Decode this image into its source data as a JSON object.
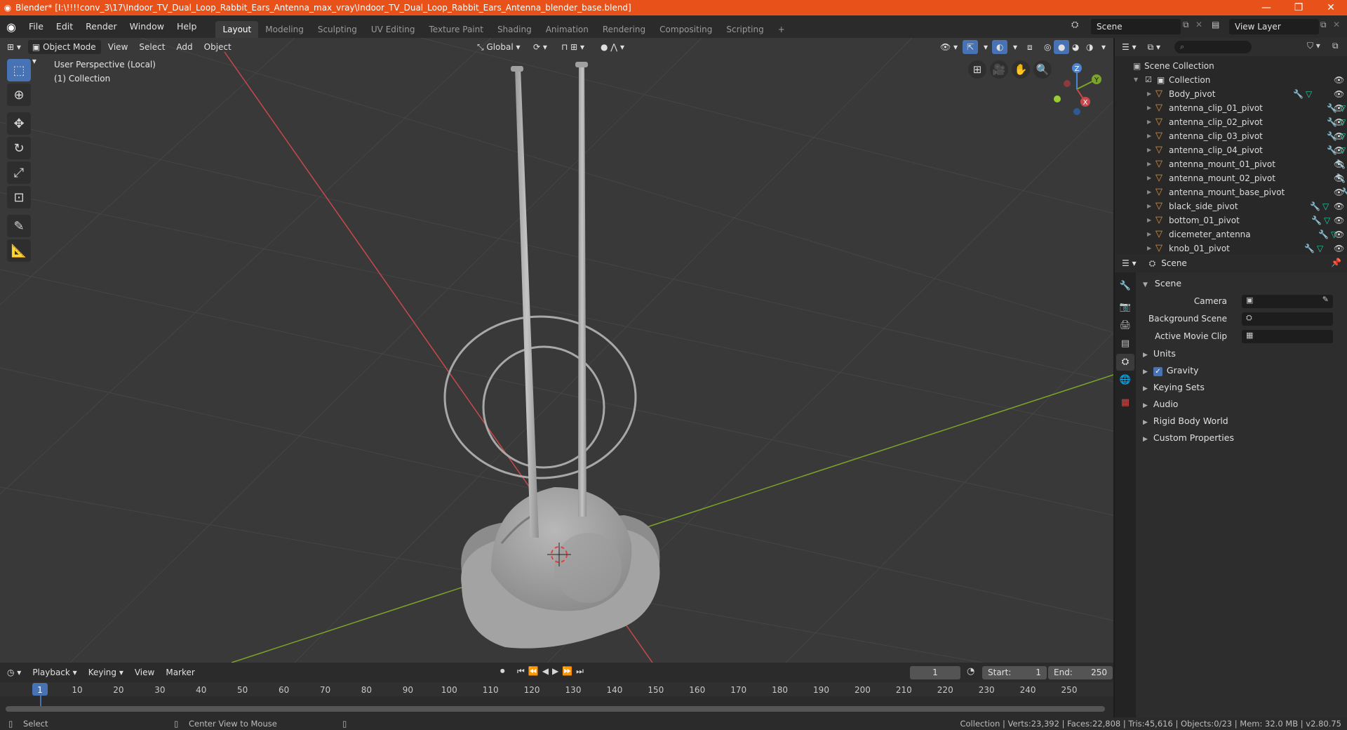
{
  "titlebar": {
    "title": "Blender* [I:\\!!!!conv_3\\17\\Indoor_TV_Dual_Loop_Rabbit_Ears_Antenna_max_vray\\Indoor_TV_Dual_Loop_Rabbit_Ears_Antenna_blender_base.blend]",
    "minimize": "—",
    "maximize": "❐",
    "close": "✕"
  },
  "menu": [
    "File",
    "Edit",
    "Render",
    "Window",
    "Help"
  ],
  "workspaces": [
    "Layout",
    "Modeling",
    "Sculpting",
    "UV Editing",
    "Texture Paint",
    "Shading",
    "Animation",
    "Rendering",
    "Compositing",
    "Scripting"
  ],
  "active_workspace": "Layout",
  "add_workspace": "+",
  "scene_selector": "Scene",
  "view_layer": "View Layer",
  "viewport": {
    "mode": "Object Mode",
    "menus": [
      "View",
      "Select",
      "Add",
      "Object"
    ],
    "orientation": "Global",
    "info_line1": "User Perspective (Local)",
    "info_line2": "(1) Collection",
    "gizmo_labels": {
      "z": "Z",
      "y": "Y",
      "x": "X"
    }
  },
  "timeline": {
    "menus": [
      "Playback",
      "Keying",
      "View",
      "Marker"
    ],
    "current_frame": "1",
    "start_label": "Start:",
    "start": "1",
    "end_label": "End:",
    "end": "250",
    "ruler": [
      "1",
      "10",
      "20",
      "30",
      "40",
      "50",
      "60",
      "70",
      "80",
      "90",
      "100",
      "110",
      "120",
      "130",
      "140",
      "150",
      "160",
      "170",
      "180",
      "190",
      "200",
      "210",
      "220",
      "230",
      "240",
      "250"
    ]
  },
  "statusbar": {
    "left1": "Select",
    "left2": "Center View to Mouse",
    "right": "Collection | Verts:23,392 | Faces:22,808 | Tris:45,616 | Objects:0/23 | Mem: 32.0 MB | v2.80.75"
  },
  "outliner": {
    "root": "Scene Collection",
    "collection": "Collection",
    "items": [
      "Body_pivot",
      "antenna_clip_01_pivot",
      "antenna_clip_02_pivot",
      "antenna_clip_03_pivot",
      "antenna_clip_04_pivot",
      "antenna_mount_01_pivot",
      "antenna_mount_02_pivot",
      "antenna_mount_base_pivot",
      "black_side_pivot",
      "bottom_01_pivot",
      "dicemeter_antenna",
      "knob_01_pivot"
    ]
  },
  "properties": {
    "context": "Scene",
    "panel": "Scene",
    "fields": [
      "Camera",
      "Background Scene",
      "Active Movie Clip"
    ],
    "sections": [
      "Units",
      "Gravity",
      "Keying Sets",
      "Audio",
      "Rigid Body World",
      "Custom Properties"
    ],
    "gravity_checked": true
  },
  "colors": {
    "titlebar": "#e8521a",
    "accent": "#4772b3",
    "object_icon": "#e4913a",
    "mesh_icon": "#27c9a0",
    "x_axis": "#c8484c",
    "y_axis": "#7aa52a"
  }
}
